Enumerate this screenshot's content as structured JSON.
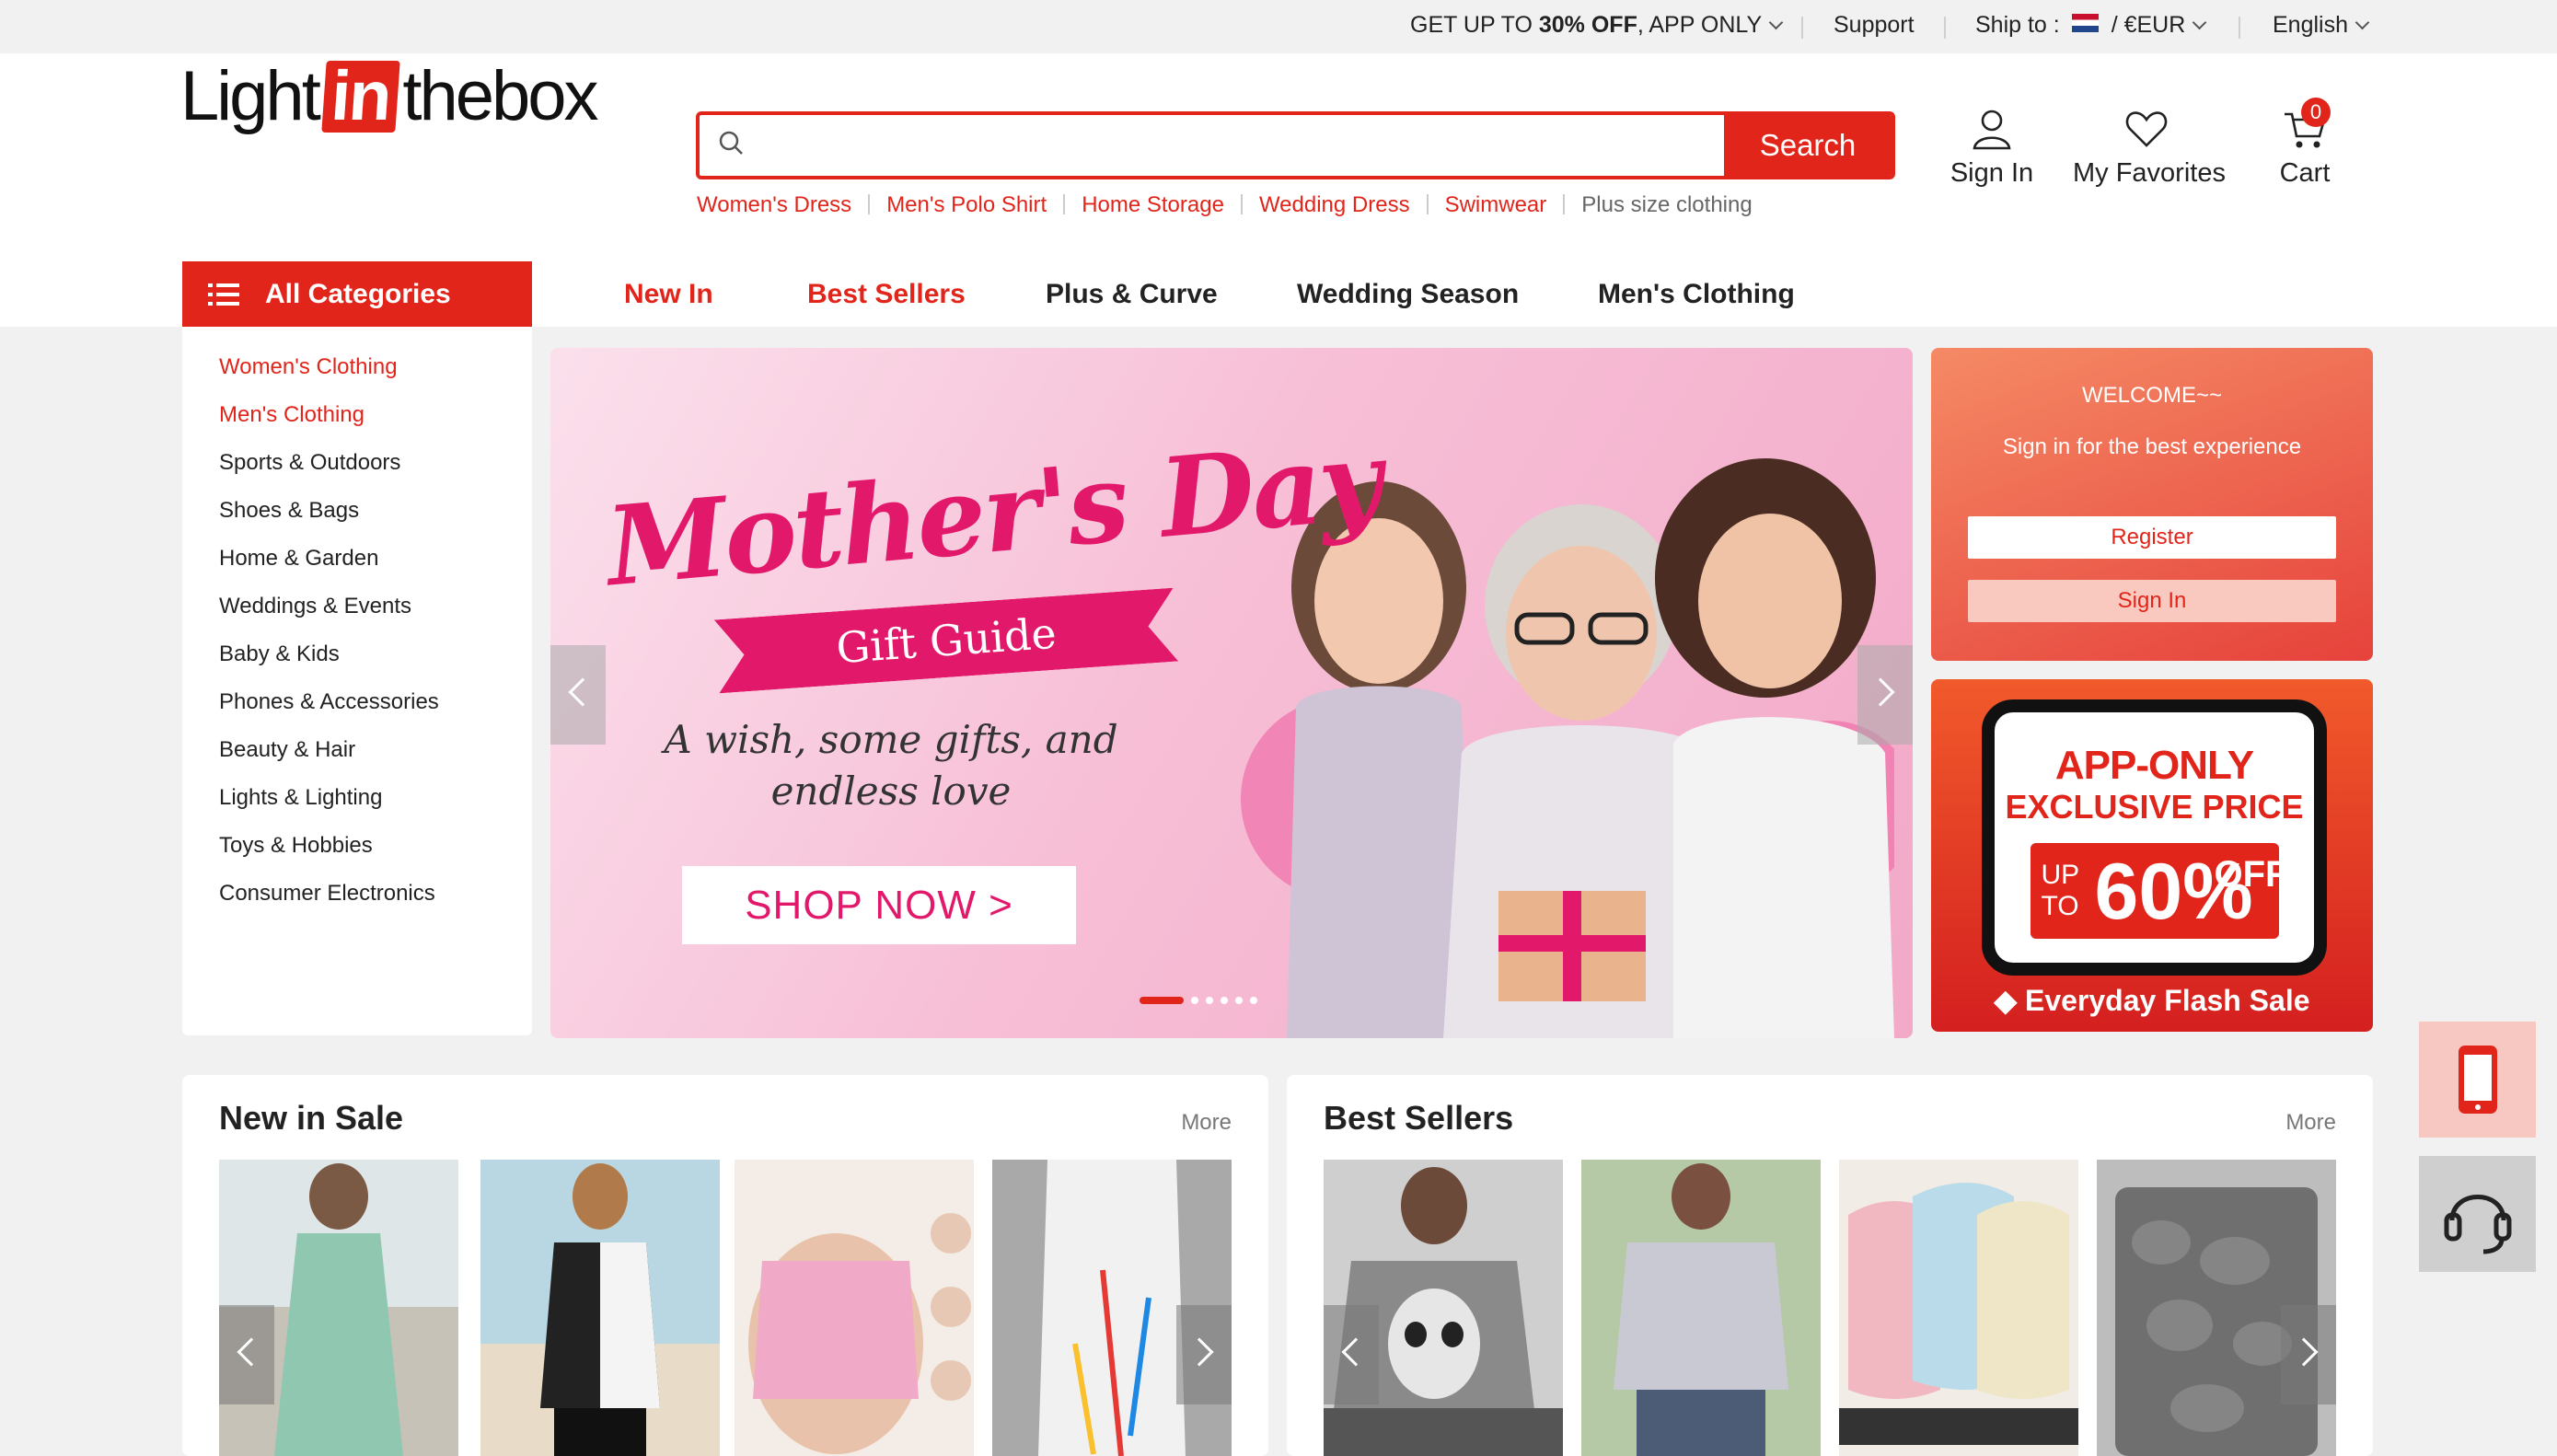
{
  "topbar": {
    "promo_prefix": "GET UP TO ",
    "promo_bold": "30% OFF",
    "promo_suffix": ", APP ONLY",
    "support": "Support",
    "ship_to": "Ship to :",
    "currency_sep": "/",
    "currency": "€EUR",
    "language": "English"
  },
  "logo": {
    "part1": "Light",
    "part2": "in",
    "part3": "thebox"
  },
  "search": {
    "placeholder": "",
    "button": "Search",
    "hot": [
      "Women's Dress",
      "Men's Polo Shirt",
      "Home Storage",
      "Wedding Dress",
      "Swimwear",
      "Plus size clothing"
    ]
  },
  "user": {
    "sign_in": "Sign In",
    "favorites": "My Favorites",
    "cart": "Cart",
    "cart_count": "0"
  },
  "nav": {
    "all_categories": "All Categories",
    "items": [
      "New In",
      "Best Sellers",
      "Plus & Curve",
      "Wedding Season",
      "Men's Clothing"
    ]
  },
  "categories": [
    "Women's Clothing",
    "Men's Clothing",
    "Sports & Outdoors",
    "Shoes & Bags",
    "Home & Garden",
    "Weddings & Events",
    "Baby & Kids",
    "Phones & Accessories",
    "Beauty & Hair",
    "Lights & Lighting",
    "Toys & Hobbies",
    "Consumer Electronics"
  ],
  "banner": {
    "title": "Mother's Day",
    "ribbon": "Gift Guide",
    "tagline_1": "A wish, some gifts, and",
    "tagline_2": "endless love",
    "cta": "SHOP NOW >"
  },
  "welcome": {
    "title": "WELCOME~~",
    "subtitle": "Sign in for the best experience",
    "register": "Register",
    "sign_in": "Sign In"
  },
  "app_promo": {
    "line1": "APP-ONLY",
    "line2": "EXCLUSIVE PRICE",
    "up_to": "UP TO",
    "percent": "60%",
    "off": "OFF",
    "flash": "Everyday Flash Sale"
  },
  "sections": {
    "new_in_sale": {
      "title": "New in Sale",
      "more": "More"
    },
    "best_sellers": {
      "title": "Best Sellers",
      "more": "More"
    }
  },
  "colors": {
    "brand": "#e1251b",
    "pink": "#e2196b"
  }
}
